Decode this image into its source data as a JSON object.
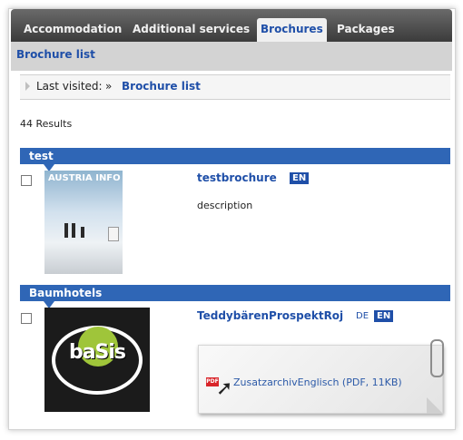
{
  "tabs": [
    {
      "label": "Accommodation",
      "active": false
    },
    {
      "label": "Additional services",
      "active": false
    },
    {
      "label": "Brochures",
      "active": true
    },
    {
      "label": "Packages",
      "active": false
    }
  ],
  "subbar": {
    "title": "Brochure list"
  },
  "breadcrumb": {
    "label": "Last visited:",
    "separator": "»",
    "link": "Brochure list"
  },
  "results": {
    "count": "44 Results"
  },
  "groups": [
    {
      "name": "test",
      "items": [
        {
          "title": "testbrochure",
          "languages": [
            {
              "code": "EN",
              "active": true
            }
          ],
          "description": "description",
          "thumbnail_text": "AUSTRIA INFO"
        }
      ]
    },
    {
      "name": "Baumhotels",
      "items": [
        {
          "title": "TeddybärenProspektRoj",
          "languages": [
            {
              "code": "DE",
              "active": false
            },
            {
              "code": "EN",
              "active": true
            }
          ],
          "thumbnail_text": "baSis",
          "attachment": {
            "icon": "pdf-icon",
            "label": "ZusatzarchivEnglisch (PDF, 11KB)"
          }
        }
      ]
    }
  ],
  "colors": {
    "accent": "#1f4fa8",
    "group_bar": "#2f66b6",
    "tabbar": "#4a4a4a"
  }
}
